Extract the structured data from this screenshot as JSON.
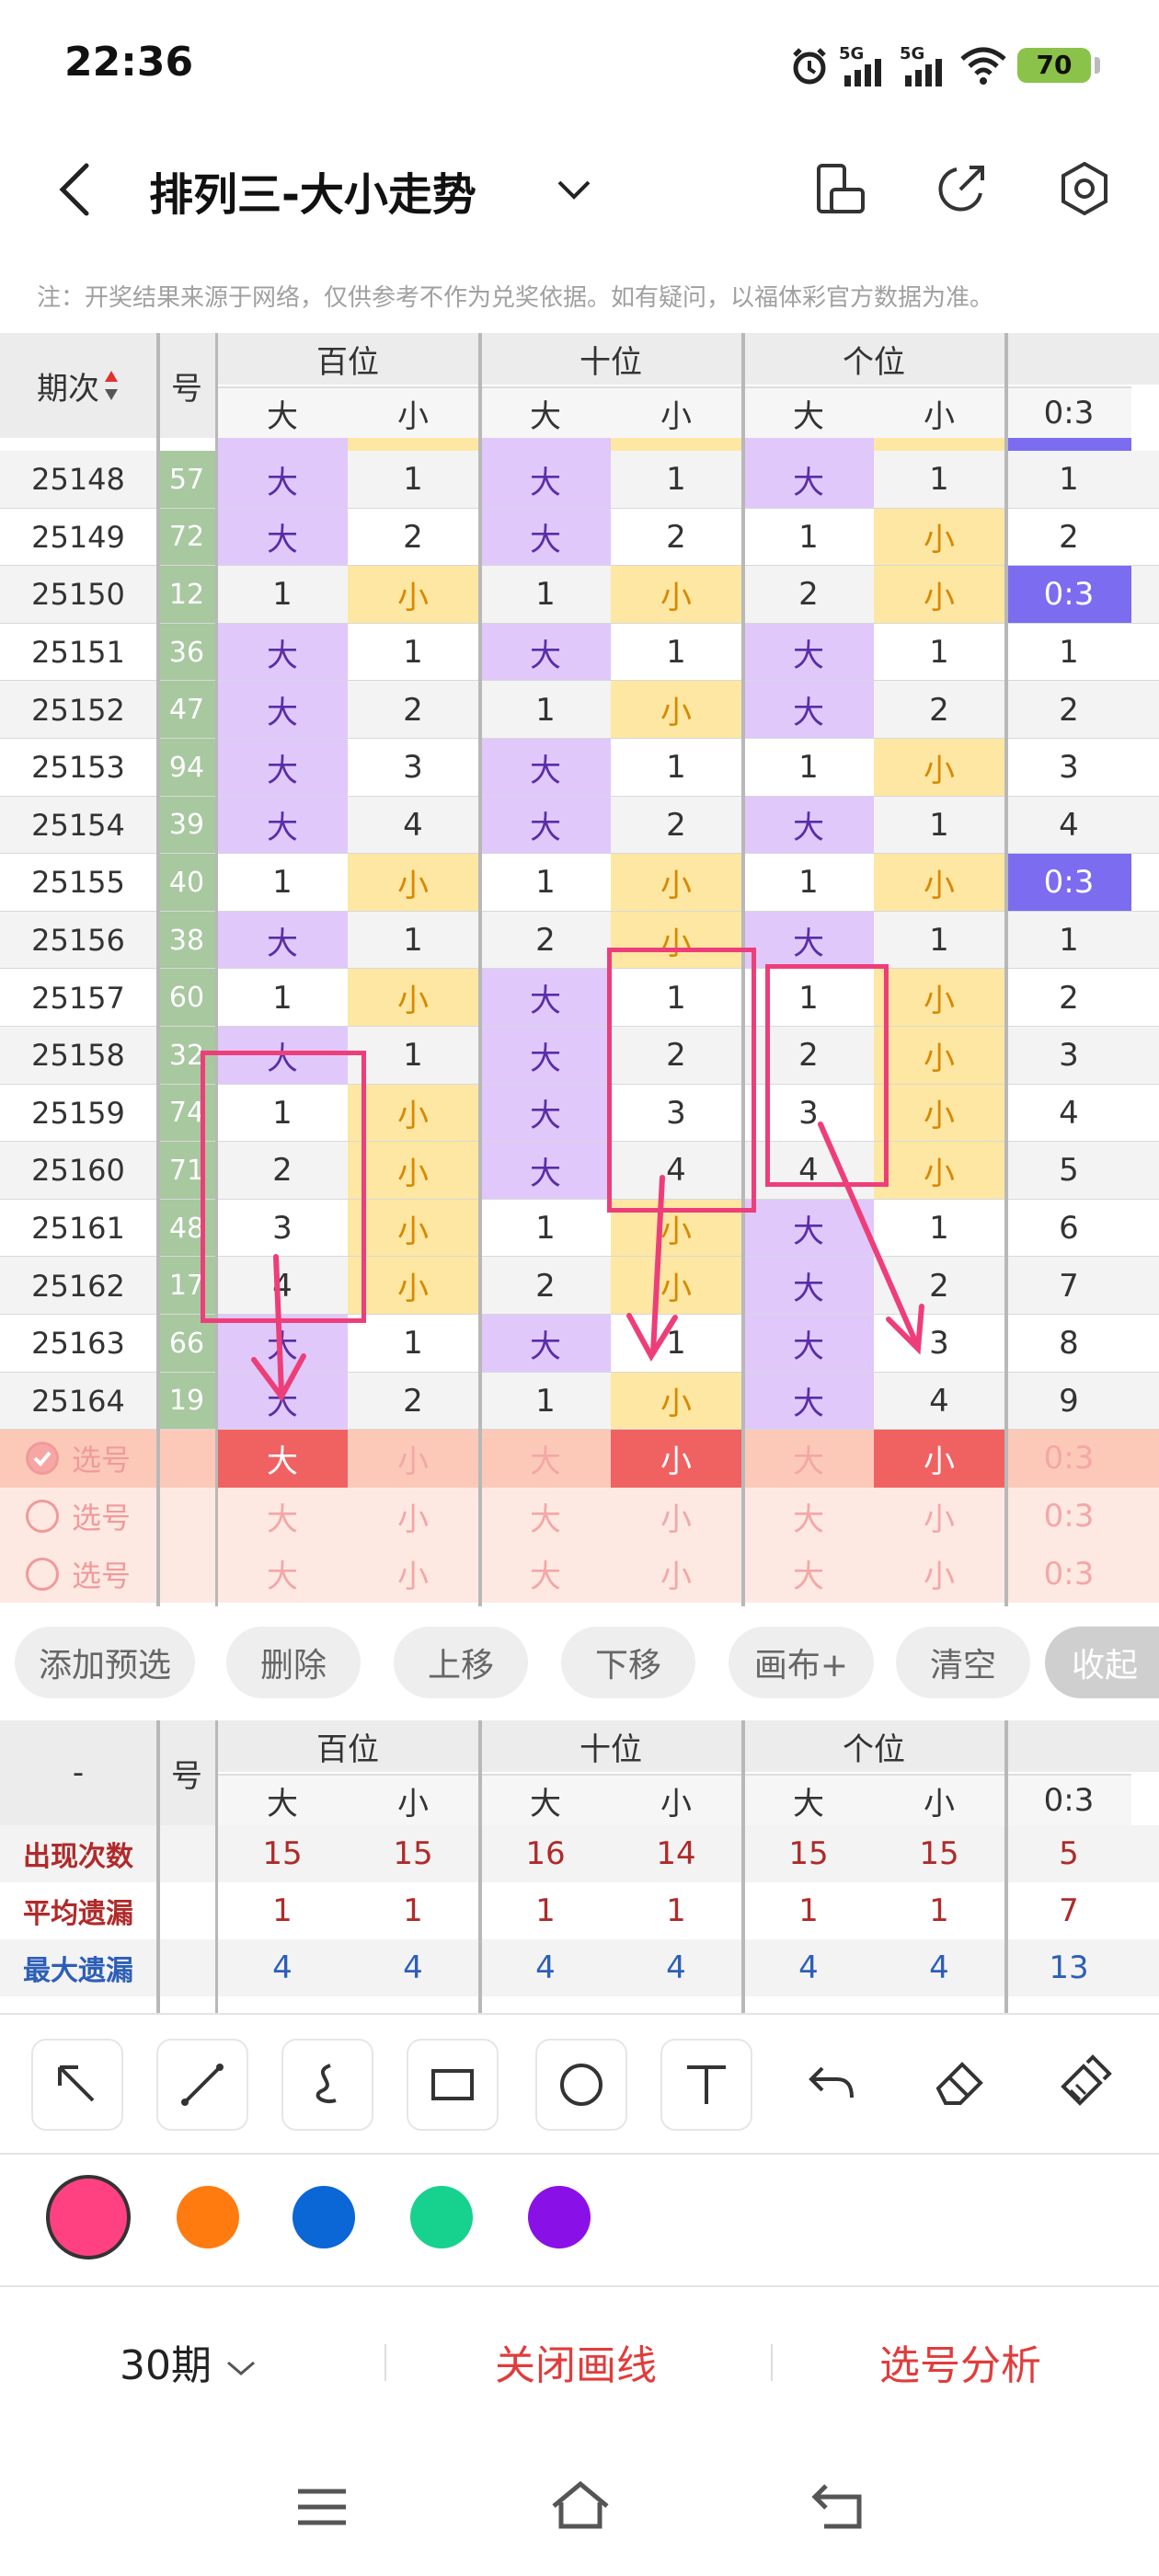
{
  "status": {
    "time": "22:36",
    "network1": "5G",
    "network2": "5G",
    "battery": "70"
  },
  "header": {
    "title": "排列三-大小走势",
    "notice": "注：开奖结果来源于网络，仅供参考不作为兑奖依据。如有疑问，以福体彩官方数据为准。"
  },
  "table": {
    "col_issue": "期次",
    "col_num": "号",
    "groups": [
      "百位",
      "十位",
      "个位"
    ],
    "sub": [
      "大",
      "小",
      "大",
      "小",
      "大",
      "小",
      "0:3"
    ],
    "rows": [
      {
        "issue": "25148",
        "num": "57",
        "vals": [
          "大",
          "1",
          "大",
          "1",
          "大",
          "1",
          "1"
        ]
      },
      {
        "issue": "25149",
        "num": "72",
        "vals": [
          "大",
          "2",
          "大",
          "2",
          "1",
          "小",
          "2"
        ]
      },
      {
        "issue": "25150",
        "num": "12",
        "vals": [
          "1",
          "小",
          "1",
          "小",
          "2",
          "小",
          "0:3"
        ]
      },
      {
        "issue": "25151",
        "num": "36",
        "vals": [
          "大",
          "1",
          "大",
          "1",
          "大",
          "1",
          "1"
        ]
      },
      {
        "issue": "25152",
        "num": "47",
        "vals": [
          "大",
          "2",
          "1",
          "小",
          "大",
          "2",
          "2"
        ]
      },
      {
        "issue": "25153",
        "num": "94",
        "vals": [
          "大",
          "3",
          "大",
          "1",
          "1",
          "小",
          "3"
        ]
      },
      {
        "issue": "25154",
        "num": "39",
        "vals": [
          "大",
          "4",
          "大",
          "2",
          "大",
          "1",
          "4"
        ]
      },
      {
        "issue": "25155",
        "num": "40",
        "vals": [
          "1",
          "小",
          "1",
          "小",
          "1",
          "小",
          "0:3"
        ]
      },
      {
        "issue": "25156",
        "num": "38",
        "vals": [
          "大",
          "1",
          "2",
          "小",
          "大",
          "1",
          "1"
        ]
      },
      {
        "issue": "25157",
        "num": "60",
        "vals": [
          "1",
          "小",
          "大",
          "1",
          "1",
          "小",
          "2"
        ]
      },
      {
        "issue": "25158",
        "num": "32",
        "vals": [
          "大",
          "1",
          "大",
          "2",
          "2",
          "小",
          "3"
        ]
      },
      {
        "issue": "25159",
        "num": "74",
        "vals": [
          "1",
          "小",
          "大",
          "3",
          "3",
          "小",
          "4"
        ]
      },
      {
        "issue": "25160",
        "num": "71",
        "vals": [
          "2",
          "小",
          "大",
          "4",
          "4",
          "小",
          "5"
        ]
      },
      {
        "issue": "25161",
        "num": "48",
        "vals": [
          "3",
          "小",
          "1",
          "小",
          "大",
          "1",
          "6"
        ]
      },
      {
        "issue": "25162",
        "num": "17",
        "vals": [
          "4",
          "小",
          "2",
          "小",
          "大",
          "2",
          "7"
        ]
      },
      {
        "issue": "25163",
        "num": "66",
        "vals": [
          "大",
          "1",
          "大",
          "1",
          "大",
          "3",
          "8"
        ]
      },
      {
        "issue": "25164",
        "num": "19",
        "vals": [
          "大",
          "2",
          "1",
          "小",
          "大",
          "4",
          "9"
        ]
      }
    ],
    "pick_label": "选号",
    "pick_rows": [
      [
        "大",
        "小",
        "大",
        "小",
        "大",
        "小",
        "0:3"
      ],
      [
        "大",
        "小",
        "大",
        "小",
        "大",
        "小",
        "0:3"
      ],
      [
        "大",
        "小",
        "大",
        "小",
        "大",
        "小",
        "0:3"
      ]
    ]
  },
  "actions": [
    "添加预选",
    "删除",
    "上移",
    "下移",
    "画布+",
    "清空",
    "收起"
  ],
  "stats": {
    "col_dash": "-",
    "col_num": "号",
    "groups": [
      "百位",
      "十位",
      "个位"
    ],
    "sub": [
      "大",
      "小",
      "大",
      "小",
      "大",
      "小",
      "0:3"
    ],
    "rows": [
      {
        "label": "出现次数",
        "vals": [
          "15",
          "15",
          "16",
          "14",
          "15",
          "15",
          "5"
        ],
        "color": "#b02a2a"
      },
      {
        "label": "平均遗漏",
        "vals": [
          "1",
          "1",
          "1",
          "1",
          "1",
          "1",
          "7"
        ],
        "color": "#b02a2a"
      },
      {
        "label": "最大遗漏",
        "vals": [
          "4",
          "4",
          "4",
          "4",
          "4",
          "4",
          "13"
        ],
        "color": "#2d5fb8"
      }
    ]
  },
  "palette": [
    "#ff4081",
    "#ff7a0f",
    "#0b66d6",
    "#17d18f",
    "#8a10e8"
  ],
  "bottom": {
    "period": "30期",
    "close_draw": "关闭画线",
    "pick_analysis": "选号分析"
  }
}
